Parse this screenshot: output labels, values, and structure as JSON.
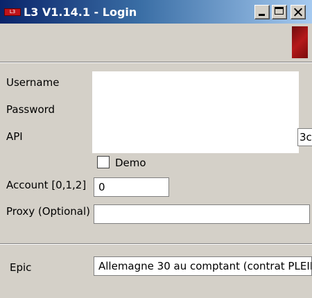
{
  "window": {
    "title": "L3 V1.14.1 - Login",
    "icon_text": "L3"
  },
  "form": {
    "username_label": "Username",
    "password_label": "Password",
    "api_label": "API",
    "api_value": "3c",
    "demo_label": "Demo",
    "demo_checked": false,
    "account_label": "Account [0,1,2]",
    "account_value": "0",
    "proxy_label": "Proxy (Optional)",
    "proxy_value": ""
  },
  "epic": {
    "label": "Epic",
    "value": "Allemagne 30 au comptant (contrat PLEIN"
  },
  "colors": {
    "titlebar_start": "#0a246a",
    "titlebar_end": "#a6caf0",
    "background": "#d4d0c8",
    "logo": "#b5191a"
  }
}
